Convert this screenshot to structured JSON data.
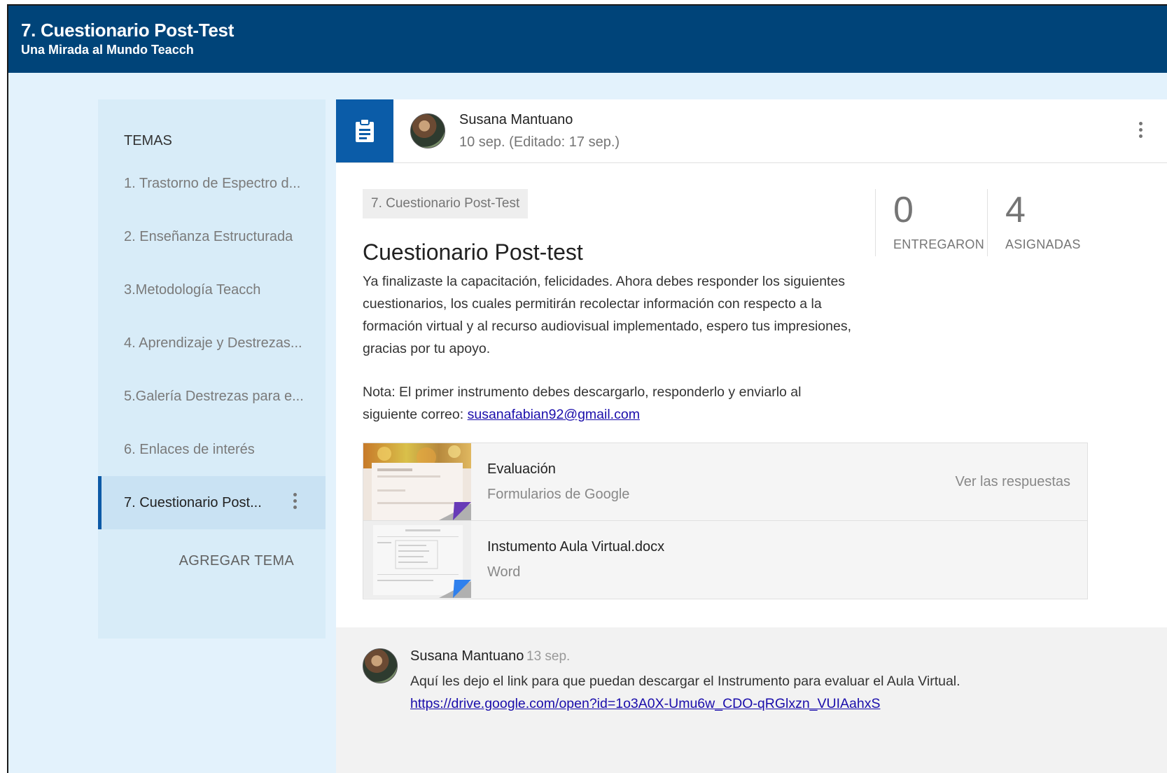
{
  "header": {
    "title": "7. Cuestionario Post-Test",
    "subtitle": "Una Mirada al Mundo Teacch"
  },
  "sidebar": {
    "heading": "TEMAS",
    "items": [
      {
        "label": "1. Trastorno de Espectro d..."
      },
      {
        "label": "2. Enseñanza Estructurada"
      },
      {
        "label": "3.Metodología Teacch"
      },
      {
        "label": "4. Aprendizaje y Destrezas..."
      },
      {
        "label": "5.Galería Destrezas para e..."
      },
      {
        "label": "6. Enlaces de interés"
      },
      {
        "label": "7. Cuestionario Post..."
      }
    ],
    "add_label": "AGREGAR TEMA"
  },
  "post": {
    "author": "Susana Mantuano",
    "date": "10 sep. (Editado: 17 sep.)",
    "topic_chip": "7. Cuestionario Post-Test",
    "title": "Cuestionario Post-test",
    "body": "Ya finalizaste la capacitación, felicidades. Ahora debes responder los siguientes cuestionarios, los cuales permitirán recolectar información con respecto a la formación virtual y al recurso audiovisual implementado, espero tus impresiones, gracias por tu apoyo.",
    "note_prefix": "Nota: El primer instrumento debes descargarlo, responderlo y enviarlo al siguiente correo: ",
    "note_email": "susanafabian92@gmail.com",
    "stats": {
      "turned_in_value": "0",
      "turned_in_label": "ENTREGARON",
      "assigned_value": "4",
      "assigned_label": "ASIGNADAS"
    },
    "attachments": [
      {
        "name": "Evaluación",
        "type": "Formularios de Google",
        "action": "Ver las respuestas",
        "corner_color": "#673ab7"
      },
      {
        "name": "Instumento Aula Virtual.docx",
        "type": "Word",
        "action": "",
        "corner_color": "#2f80ed"
      }
    ]
  },
  "comment": {
    "author": "Susana Mantuano",
    "date": "13 sep.",
    "text": "Aquí les dejo el link para que puedan descargar el Instrumento para evaluar el Aula Virtual.",
    "link": "https://drive.google.com/open?id=1o3A0X-Umu6w_CDO-qRGlxzn_VUIAahxS"
  },
  "colors": {
    "header_bg": "#004479",
    "accent": "#0b5ca8",
    "page_bg": "#e3f2fc"
  }
}
